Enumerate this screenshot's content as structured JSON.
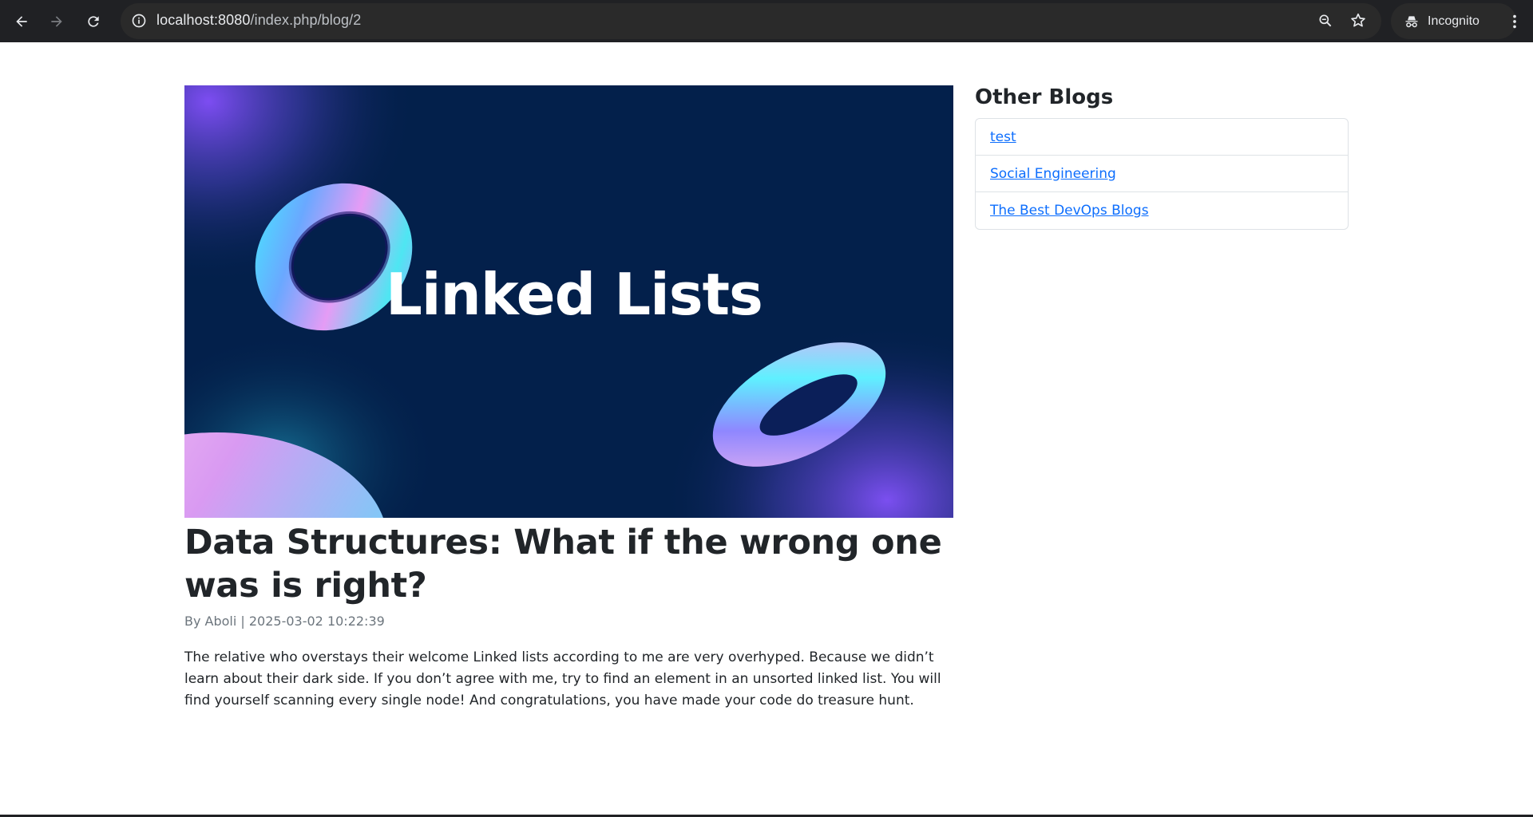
{
  "browser": {
    "url_host": "localhost:8080",
    "url_path": "/index.php/blog/2",
    "incognito_label": "Incognito"
  },
  "post": {
    "hero_text": "Linked Lists",
    "title": "Data Structures: What if the wrong one was is right?",
    "meta": "By Aboli | 2025-03-02 10:22:39",
    "body": "The relative who overstays their welcome Linked lists according to me are very overhyped. Because we didn’t learn about their dark side. If you don’t agree with me, try to find an element in an unsorted linked list. You will find yourself scanning every single node! And congratulations, you have made your code do treasure hunt."
  },
  "sidebar": {
    "title": "Other Blogs",
    "links": [
      {
        "label": "test"
      },
      {
        "label": "Social Engineering"
      },
      {
        "label": "The Best DevOps Blogs"
      }
    ]
  },
  "colors": {
    "chrome_bg": "#202124",
    "omnibox_bg": "#2a2a2a",
    "hero_bg": "#03204b",
    "link": "#0d6efd",
    "text": "#212529",
    "muted": "#6c757d"
  },
  "icons": [
    "back-arrow-icon",
    "forward-arrow-icon",
    "reload-icon",
    "site-info-icon",
    "zoom-icon",
    "bookmark-star-icon",
    "incognito-icon",
    "more-menu-icon"
  ]
}
